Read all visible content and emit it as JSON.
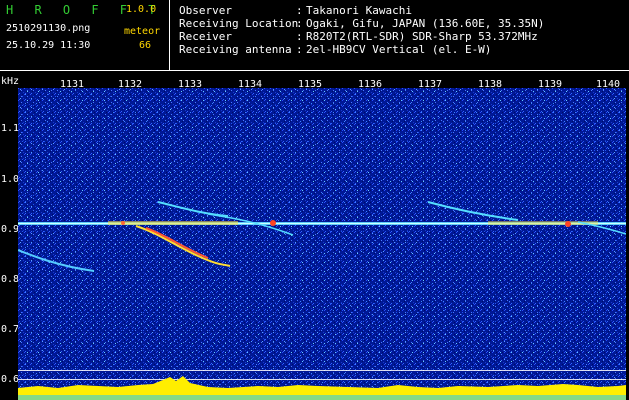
{
  "app": {
    "logo": "H R O F F T",
    "version": "1.0.0"
  },
  "file": {
    "name": "2510291130.png",
    "datetime": "25.10.29 11:30"
  },
  "meteor": {
    "label": "meteor",
    "count": "66"
  },
  "info": [
    {
      "key": "Observer",
      "sep": ":",
      "value": "Takanori Kawachi"
    },
    {
      "key": "Receiving Location",
      "sep": ":",
      "value": "Ogaki, Gifu, JAPAN (136.60E, 35.35N)"
    },
    {
      "key": "Receiver",
      "sep": ":",
      "value": "R820T2(RTL-SDR) SDR-Sharp 53.372MHz"
    },
    {
      "key": "Receiving antenna",
      "sep": ":",
      "value": "2el-HB9CV Vertical (el. E-W)"
    }
  ],
  "axis": {
    "unit": "kHz",
    "y_ticks": [
      "1.1",
      "1.0",
      "0.9",
      "0.8",
      "0.7",
      "0.6"
    ],
    "x_ticks": [
      "1131",
      "1132",
      "1133",
      "1134",
      "1135",
      "1136",
      "1137",
      "1138",
      "1139",
      "1140"
    ]
  },
  "colors": {
    "background": "#000000",
    "noise": "#001a99",
    "text": "#ffffff",
    "logo": "#33cc33",
    "accent": "#ffd700"
  }
}
